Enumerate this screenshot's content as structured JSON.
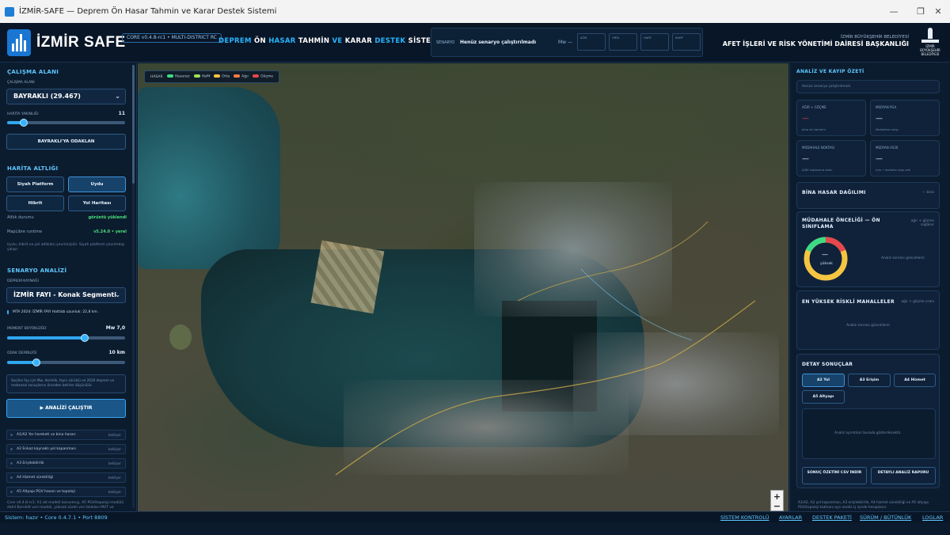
{
  "window": {
    "title": "İZMİR-SAFE — Deprem Ön Hasar Tahmin ve Karar Destek Sistemi"
  },
  "header": {
    "brand": "İZMİR SAFE",
    "core_pill": "CORE v0.4.8-rc1 • MULTI-DISTRICT RC",
    "title_parts": [
      "DEPREM",
      "ÖN",
      "HASAR",
      "TAHMİN",
      "VE",
      "KARAR",
      "DESTEK",
      "SİSTEMİ"
    ],
    "scenario_label": "SENARYO",
    "scenario_value": "Henüz senaryo çalıştırılmadı",
    "mw_label": "Mw —",
    "metrics": [
      "AĞIR",
      "ORTA",
      "HAFİF",
      "KAYIP"
    ],
    "org_line1": "İZMİR BÜYÜKŞEHİR BELEDİYESİ",
    "org_line2": "AFET İŞLERİ VE RİSK YÖNETİMİ DAİRESİ BAŞKANLIĞI",
    "logo_text": [
      "İZMİR",
      "BÜYÜKŞEHİR",
      "BELEDİYESİ"
    ]
  },
  "sidebar": {
    "study_area_title": "ÇALIŞMA ALANI",
    "study_area_label": "ÇALIŞMA ALANI",
    "district_select": "BAYRAKLI (29.467)",
    "zoom_label": "HARİTA YAKINLIĞI",
    "zoom_value": "11",
    "zoom_fraction": 0.14,
    "focus_button": "BAYRAKLI'YA ODAKLAN",
    "basemap_title": "HARİTA ALTLIĞI",
    "basemap_buttons": [
      "Siyah Platform",
      "Uydu",
      "Hibrit",
      "Yol Haritası"
    ],
    "active_basemap": "Uydu",
    "status_rows": [
      {
        "label": "Altlık durumu",
        "value": "görüntü yüklendi"
      },
      {
        "label": "MapLibre runtime",
        "value": "v5.24.0 • yerel"
      }
    ],
    "basemap_note": "Uydu, hibrit ve yol altlıkları çevrimiçidir. Siyah platform çevrimdışı çalışır.",
    "scenario_title": "SENARYO ANALİZİ",
    "source_label": "DEPREM KAYNAĞI",
    "source_select": "İZMİR FAYI - Konak Segmenti",
    "source_info": "MTA 2024: İZMİR FAYI Hattiab uzunluk: 22,8 km.",
    "moment_label": "MOMENT BÜYÜKLÜĞÜ",
    "moment_value": "Mw 7,0",
    "moment_fraction": 0.66,
    "depth_label": "ODAK DERİNLİĞİ",
    "depth_value": "10 km",
    "depth_fraction": 0.25,
    "scenario_note": "Seçilen fay için Mw, derinlik, fayın sürüklü ve 2020 deprem ve mekansal sonuçlarını önceden belirler düşünülür.",
    "run_button": "▶ ANALİZİ ÇALIŞTIR",
    "steps": [
      {
        "label": "A1/A2 Yer hareketi ve bina hasarı",
        "status": "bekliyor"
      },
      {
        "label": "A2 Enkaz kaynaklı yol kapanması",
        "status": "bekliyor"
      },
      {
        "label": "A3 Erişilebilirlik",
        "status": "bekliyor"
      },
      {
        "label": "A4 Hizmet sürekliliği",
        "status": "bekliyor"
      },
      {
        "label": "A5 Altyapı PGV hasarı ve topoloji",
        "status": "bekliyor"
      }
    ],
    "footer_note": "Core v0.4.8-rc1: A1 ait modeli korunmuş, A5 PGV/topoloji modülü dahil Bornklit veri modeli, yüksek süreli veri blokları MVT ve"
  },
  "map": {
    "legend_label": "HASAR",
    "legend": [
      {
        "label": "Hasarsız",
        "color": "#3ddc84"
      },
      {
        "label": "Hafif",
        "color": "#9be15d"
      },
      {
        "label": "Orta",
        "color": "#f5c542"
      },
      {
        "label": "Ağır",
        "color": "#f57c42"
      },
      {
        "label": "Göçme",
        "color": "#e5484d"
      }
    ],
    "zoom_in": "+",
    "zoom_out": "−"
  },
  "right": {
    "summary_title": "ANALİZ VE KAYIP ÖZETİ",
    "summary_note": "Henüz senaryo çalıştırılmadı.",
    "metric_cards": [
      {
        "label": "AĞIR + GÖÇME",
        "value": "—",
        "sub": "bina ön tahmini"
      },
      {
        "label": "MEDYAN PGA",
        "value": "—",
        "sub": "Mahallere ulaşı"
      },
      {
        "label": "MÜDAHALE NOKTASI",
        "value": "—",
        "sub": "A/SK toplanma alanı"
      },
      {
        "label": "MEDYAN VS30",
        "value": "—",
        "sub": "m/s • mahalle yapı seti"
      }
    ],
    "distribution_title": "BİNA HASAR DAĞILIMI",
    "distribution_note": "— bina",
    "priority_title": "MÜDAHALE ÖNCELİĞİ — ÖN SINIFLAMA",
    "priority_note": "ağır + göçme sağlanır",
    "donut_value": "—",
    "donut_label": "yüksek",
    "priority_empty": "Analiz sonrası güncellenir.",
    "risk_title": "EN YÜKSEK RİSKLİ MAHALLELER",
    "risk_note": "ağır + göçme oranı",
    "risk_empty": "Analiz sonrası güncellenir.",
    "details_title": "DETAY SONUÇLAR",
    "detail_tabs": [
      "A2 Yol",
      "A3 Erişim",
      "A4 Hizmet",
      "A5 Altyapı"
    ],
    "active_tab": "A2 Yol",
    "details_empty": "Analiz ayrıntıları burada gösterilecektir.",
    "export_csv": "SONUÇ ÖZETİNİ CSV İNDİR",
    "export_report": "DETAYLI ANALİZ RAPORU",
    "footer_note": "A1/A2, A2 yol kapanması, A3 erişilebilirlik, A4 hizmet sürekliliği ve A5 altyapı PGV/topoloji katmanı ayrı analiz iş içinde hesaplanır."
  },
  "status": {
    "left": "Sistem: hazır • Core 0.4.7.1 • Port 8809",
    "links": [
      "SİSTEM KONTROLÜ",
      "AYARLAR",
      "DESTEK PAKETİ",
      "SÜRÜM / BÜTÜNLÜK",
      "LOGLAR"
    ]
  },
  "colors": {
    "accent": "#2ea8f0",
    "panel": "#0c1c2f",
    "success": "#47e07a"
  }
}
